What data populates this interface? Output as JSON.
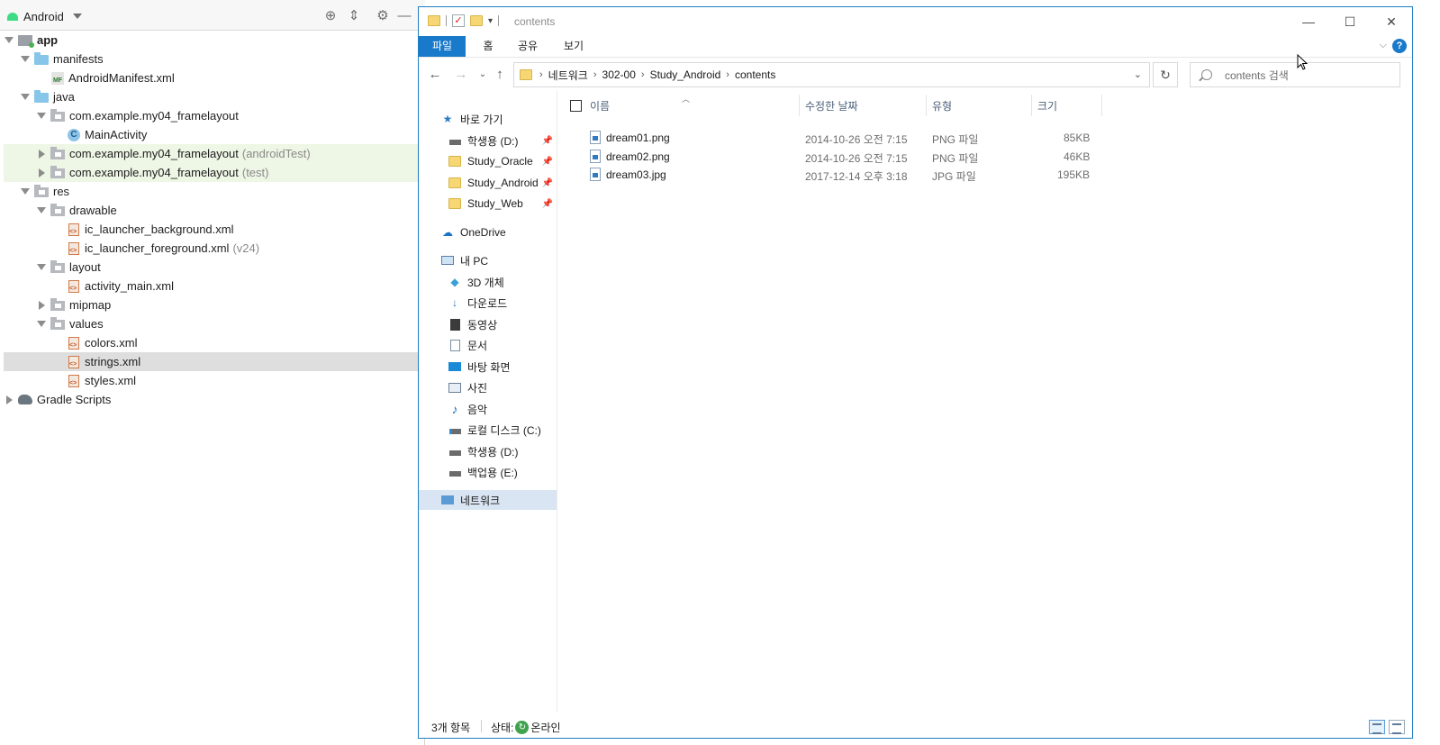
{
  "android_studio": {
    "view_selector": "Android",
    "tree": [
      {
        "label": "app",
        "sub": ""
      },
      {
        "label": "manifests",
        "sub": ""
      },
      {
        "label": "AndroidManifest.xml",
        "sub": ""
      },
      {
        "label": "java",
        "sub": ""
      },
      {
        "label": "com.example.my04_framelayout",
        "sub": ""
      },
      {
        "label": "MainActivity",
        "sub": ""
      },
      {
        "label": "com.example.my04_framelayout",
        "sub": "(androidTest)"
      },
      {
        "label": "com.example.my04_framelayout",
        "sub": "(test)"
      },
      {
        "label": "res",
        "sub": ""
      },
      {
        "label": "drawable",
        "sub": ""
      },
      {
        "label": "ic_launcher_background.xml",
        "sub": ""
      },
      {
        "label": "ic_launcher_foreground.xml",
        "sub": "(v24)"
      },
      {
        "label": "layout",
        "sub": ""
      },
      {
        "label": "activity_main.xml",
        "sub": ""
      },
      {
        "label": "mipmap",
        "sub": ""
      },
      {
        "label": "values",
        "sub": ""
      },
      {
        "label": "colors.xml",
        "sub": ""
      },
      {
        "label": "strings.xml",
        "sub": ""
      },
      {
        "label": "styles.xml",
        "sub": ""
      },
      {
        "label": "Gradle Scripts",
        "sub": ""
      }
    ],
    "manifest_badge": "MF",
    "class_badge": "C"
  },
  "explorer": {
    "title": "contents",
    "ribbon_tabs": [
      "파일",
      "홈",
      "공유",
      "보기"
    ],
    "help_label": "?",
    "breadcrumb": [
      "네트워크",
      "302-00",
      "Study_Android",
      "contents"
    ],
    "search_placeholder": "contents 검색",
    "nav_pane": {
      "quick_access": "바로 가기",
      "pinned": [
        "학생용 (D:)",
        "Study_Oracle",
        "Study_Android",
        "Study_Web"
      ],
      "onedrive": "OneDrive",
      "this_pc": "내 PC",
      "pc_items": [
        "3D 개체",
        "다운로드",
        "동영상",
        "문서",
        "바탕 화면",
        "사진",
        "음악",
        "로컬 디스크 (C:)",
        "학생용 (D:)",
        "백업용 (E:)"
      ],
      "network": "네트워크"
    },
    "columns": [
      "이름",
      "수정한 날짜",
      "유형",
      "크기"
    ],
    "files": [
      {
        "name": "dream01.png",
        "modified": "2014-10-26 오전 7:15",
        "type": "PNG 파일",
        "size": "85KB"
      },
      {
        "name": "dream02.png",
        "modified": "2014-10-26 오전 7:15",
        "type": "PNG 파일",
        "size": "46KB"
      },
      {
        "name": "dream03.jpg",
        "modified": "2017-12-14 오후 3:18",
        "type": "JPG 파일",
        "size": "195KB"
      }
    ],
    "status": {
      "count": "3개 항목",
      "state_label": "상태:",
      "state_value": "온라인"
    }
  }
}
